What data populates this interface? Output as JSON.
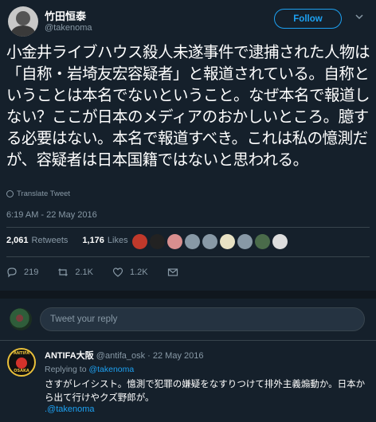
{
  "author": {
    "name": "竹田恒泰",
    "handle": "@takenoma"
  },
  "follow_label": "Follow",
  "tweet": {
    "text": "小金井ライブハウス殺人未遂事件で逮捕された人物は「自称・岩埼友宏容疑者」と報道されている。自称ということは本名でないということ。なぜ本名で報道しない？ここが日本のメディアのおかしいところ。臆する必要はない。本名で報道すべき。これは私の憶測だが、容疑者は日本国籍ではないと思われる。",
    "translate_label": "Translate Tweet",
    "timestamp": "6:19 AM - 22 May 2016"
  },
  "stats": {
    "retweets_count": "2,061",
    "retweets_label": "Retweets",
    "likes_count": "1,176",
    "likes_label": "Likes",
    "liker_avatar_colors": [
      "#c0392b",
      "#222222",
      "#d98f8f",
      "#8899a6",
      "#8899a6",
      "#e8e2c4",
      "#8899a6",
      "#4a6b4a",
      "#dddddd"
    ]
  },
  "actions": {
    "replies": "219",
    "retweets": "2.1K",
    "likes": "1.2K"
  },
  "compose": {
    "placeholder": "Tweet your reply"
  },
  "reply": {
    "name": "ANTIFA大阪",
    "handle": "@antifa_osk",
    "date": "· 22 May 2016",
    "replying_to_label": "Replying to",
    "replying_to_handle": "@takenoma",
    "text": "さすがレイシスト。憶測で犯罪の嫌疑をなすりつけて排外主義煽動か。日本から出て行けやクズ野郎が。",
    "mention": ".@takenoma",
    "avatar_top": "ANTIFA",
    "avatar_bottom": "OSAKA"
  },
  "colors": {
    "background": "#15202b",
    "accent": "#1da1f2",
    "muted": "#8899a6"
  }
}
